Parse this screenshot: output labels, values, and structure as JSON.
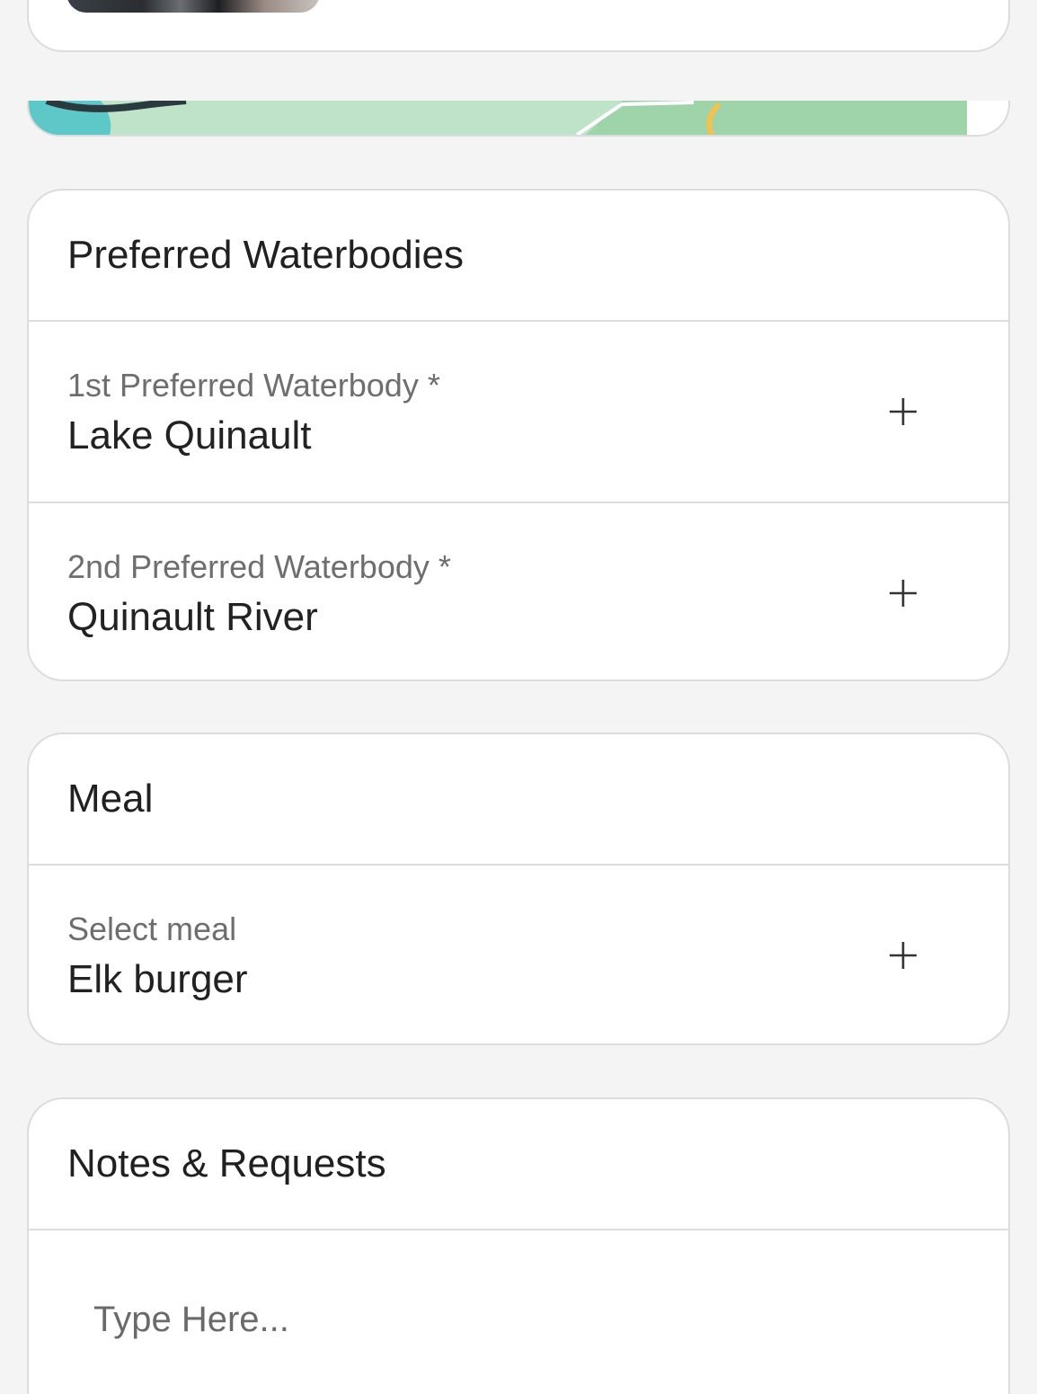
{
  "preferred_waterbodies": {
    "title": "Preferred Waterbodies",
    "first": {
      "label": "1st Preferred Waterbody *",
      "value": "Lake Quinault"
    },
    "second": {
      "label": "2nd Preferred Waterbody *",
      "value": "Quinault River"
    }
  },
  "meal": {
    "title": "Meal",
    "select": {
      "label": "Select meal",
      "value": "Elk burger"
    }
  },
  "notes": {
    "title": "Notes & Requests",
    "placeholder": "Type Here..."
  },
  "icons": {
    "add": "plus-icon"
  },
  "colors": {
    "background": "#f4f4f4",
    "card": "#ffffff",
    "border": "#dcdcdc",
    "label": "#6e6e6e",
    "text": "#222222",
    "map_water": "#5ec8c9",
    "map_land": "#bfe3c8"
  }
}
